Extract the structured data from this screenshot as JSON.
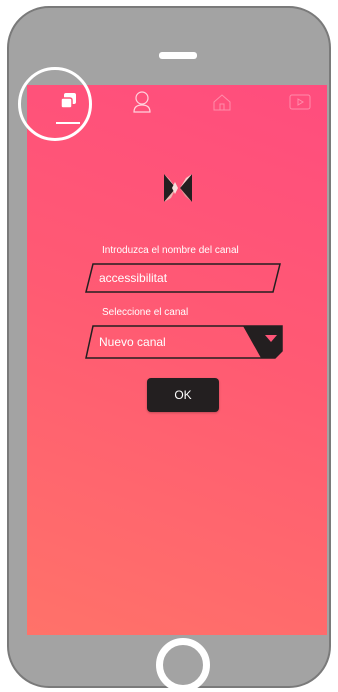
{
  "tabs": [
    {
      "icon": "channels-icon",
      "active": true
    },
    {
      "icon": "user-icon",
      "active": false
    },
    {
      "icon": "home-icon",
      "active": false
    },
    {
      "icon": "play-icon",
      "active": false
    }
  ],
  "form": {
    "name_label": "Introduzca el nombre del canal",
    "name_value": "accessibilitat",
    "channel_label": "Seleccione el canal",
    "channel_value": "Nuevo canal",
    "ok_label": "OK"
  },
  "colors": {
    "screen_top": "#ff4d7e",
    "screen_bottom": "#ff7269",
    "button_dark": "#231f20",
    "device_gray": "#a3a3a3"
  }
}
